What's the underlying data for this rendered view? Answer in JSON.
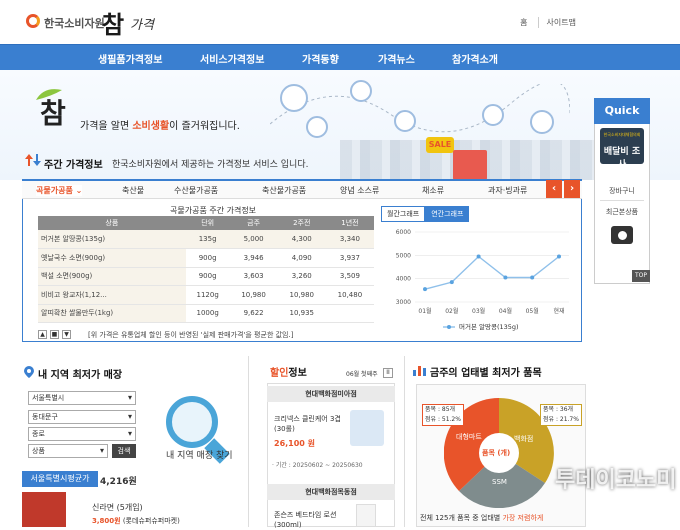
{
  "header": {
    "org": "한국소비자원",
    "logo_main": "참",
    "logo_sub": "가격",
    "links": [
      "홈",
      "사이트맵"
    ]
  },
  "gnb": [
    "생필품가격정보",
    "서비스가격정보",
    "가격동향",
    "가격뉴스",
    "참가격소개"
  ],
  "banner": {
    "logo": "참",
    "slogan_pre": "가격을 알면 ",
    "slogan_em": "소비생활",
    "slogan_post": "이 즐거워집니다.",
    "sale": "SALE"
  },
  "weekly": {
    "title": "주간 가격정보",
    "desc": "한국소비자원에서 제공하는 가격정보 서비스 입니다."
  },
  "tabs": [
    "곡물가공품",
    "축산물",
    "수산물가공품",
    "축산물가공품",
    "양념 소스류",
    "채소류",
    "과자·빙과류"
  ],
  "table": {
    "title": "곡물가공품 주간 가격정보",
    "headers": [
      "상품",
      "단위",
      "금주",
      "2주전",
      "1년전"
    ],
    "rows": [
      [
        "머거본 알땅콩(135g)",
        "135g",
        "5,000",
        "4,300",
        "3,340"
      ],
      [
        "옛날국수 소면(900g)",
        "900g",
        "3,946",
        "4,090",
        "3,937"
      ],
      [
        "백설 소면(900g)",
        "900g",
        "3,603",
        "3,260",
        "3,509"
      ],
      [
        "비비고 왕교자(1,12...",
        "1120g",
        "10,980",
        "10,980",
        "10,480"
      ],
      [
        "알띠확찬 쌀물만두(1kg)",
        "1000g",
        "9,622",
        "10,935",
        ""
      ]
    ],
    "pager": [
      "▲",
      "■",
      "▼"
    ],
    "note": "[위 가격은 유통업체 할인 등이 반영된 '실제 판매가격'을 평균한 값임.]"
  },
  "graph_tabs": [
    "월간그래프",
    "연간그래프"
  ],
  "chart_data": {
    "type": "line",
    "categories": [
      "01월",
      "02월",
      "03월",
      "04월",
      "05월",
      "현재"
    ],
    "series": [
      {
        "name": "머거본 알땅콩(135g)",
        "values": [
          3550,
          3850,
          4950,
          4050,
          4050,
          4950
        ]
      }
    ],
    "yticks": [
      3000,
      4000,
      5000,
      6000
    ],
    "ylim": [
      3000,
      6000
    ],
    "grid": true,
    "legend": "bottom"
  },
  "quick": {
    "title": "Quick",
    "baedal_top": "한국소비자대체협의회",
    "baedal_main": "배달비 조사",
    "items": [
      "장바구니",
      "최근본상품"
    ],
    "top": "TOP"
  },
  "local": {
    "title": "내 지역 최저가 매장",
    "selects": [
      "서울특별시",
      "동대문구",
      "종로",
      "상품"
    ],
    "search": "검색",
    "caption": "내 지역 매장 찾기",
    "avg_label": "서울특별시평균가",
    "avg_value": "4,216원",
    "item_name": "신라면 (5개입)",
    "item_price": "3,800원",
    "item_store": "(롯데슈퍼슈퍼마켓)"
  },
  "discount": {
    "title_a": "할인",
    "title_b": "정보",
    "week": "06월 첫째주",
    "pause": "II",
    "store1": "현대백화점미아점",
    "product": "크리넥스 클린케어 3겹 (30롤)",
    "price": "26,100 원",
    "period": "· 기간 : 20250602 ~ 20250630",
    "store2": "현대백화점목동점",
    "product2": "존슨즈 베드타임 로션 (300ml)"
  },
  "industry": {
    "title": "금주의 업태별 최저가 품목",
    "pie_labels": [
      "대형마트",
      "백화점",
      "SSM"
    ],
    "center": "품목 (개)",
    "callout_l": [
      "품목 : 85개",
      "점유 : 51.2%"
    ],
    "callout_r": [
      "품목 : 36개",
      "점유 : 21.7%"
    ],
    "note_pre": "전체 125개 품목 중 업태별 ",
    "note_em": "가장 저렴하게"
  },
  "watermark": "투데이코노미",
  "colors": {
    "primary": "#3a7fd0",
    "accent": "#e8542a",
    "pie_red": "#e8542a",
    "pie_gold": "#c9a227",
    "pie_gray": "#7f8c8d"
  }
}
